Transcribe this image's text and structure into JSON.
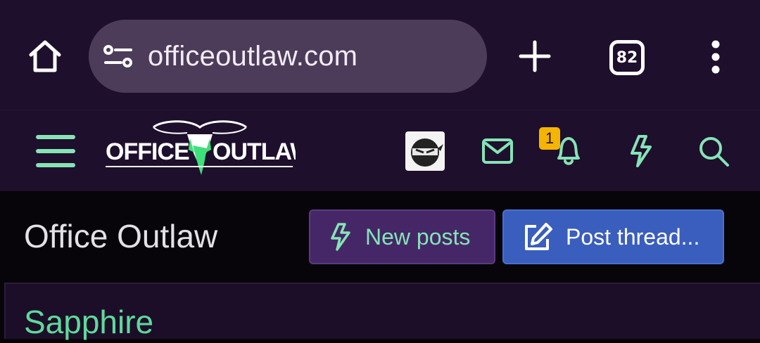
{
  "browser": {
    "url": "officeoutlaw.com",
    "tab_count": "82",
    "icons": [
      "home-icon",
      "site-settings-icon",
      "new-tab-icon",
      "tab-switcher-icon",
      "more-menu-icon"
    ]
  },
  "site_header": {
    "logo_text": "OFFICE OUTLAW",
    "notification_count": "1",
    "icons": [
      "hamburger-menu-icon",
      "avatar",
      "mail-icon",
      "bell-icon",
      "lightning-icon",
      "search-icon"
    ]
  },
  "main": {
    "title": "Office Outlaw",
    "buttons": {
      "new_posts": "New posts",
      "post_thread": "Post thread..."
    },
    "first_section_title": "Sapphire"
  },
  "colors": {
    "header_bg": "#1e0f2c",
    "url_pill": "#4c3c5a",
    "accent_green": "#86e3b6",
    "new_posts_bg": "#452767",
    "post_thread_bg": "#3a5ebd",
    "badge": "#f5b400",
    "page_bg": "#070509"
  }
}
